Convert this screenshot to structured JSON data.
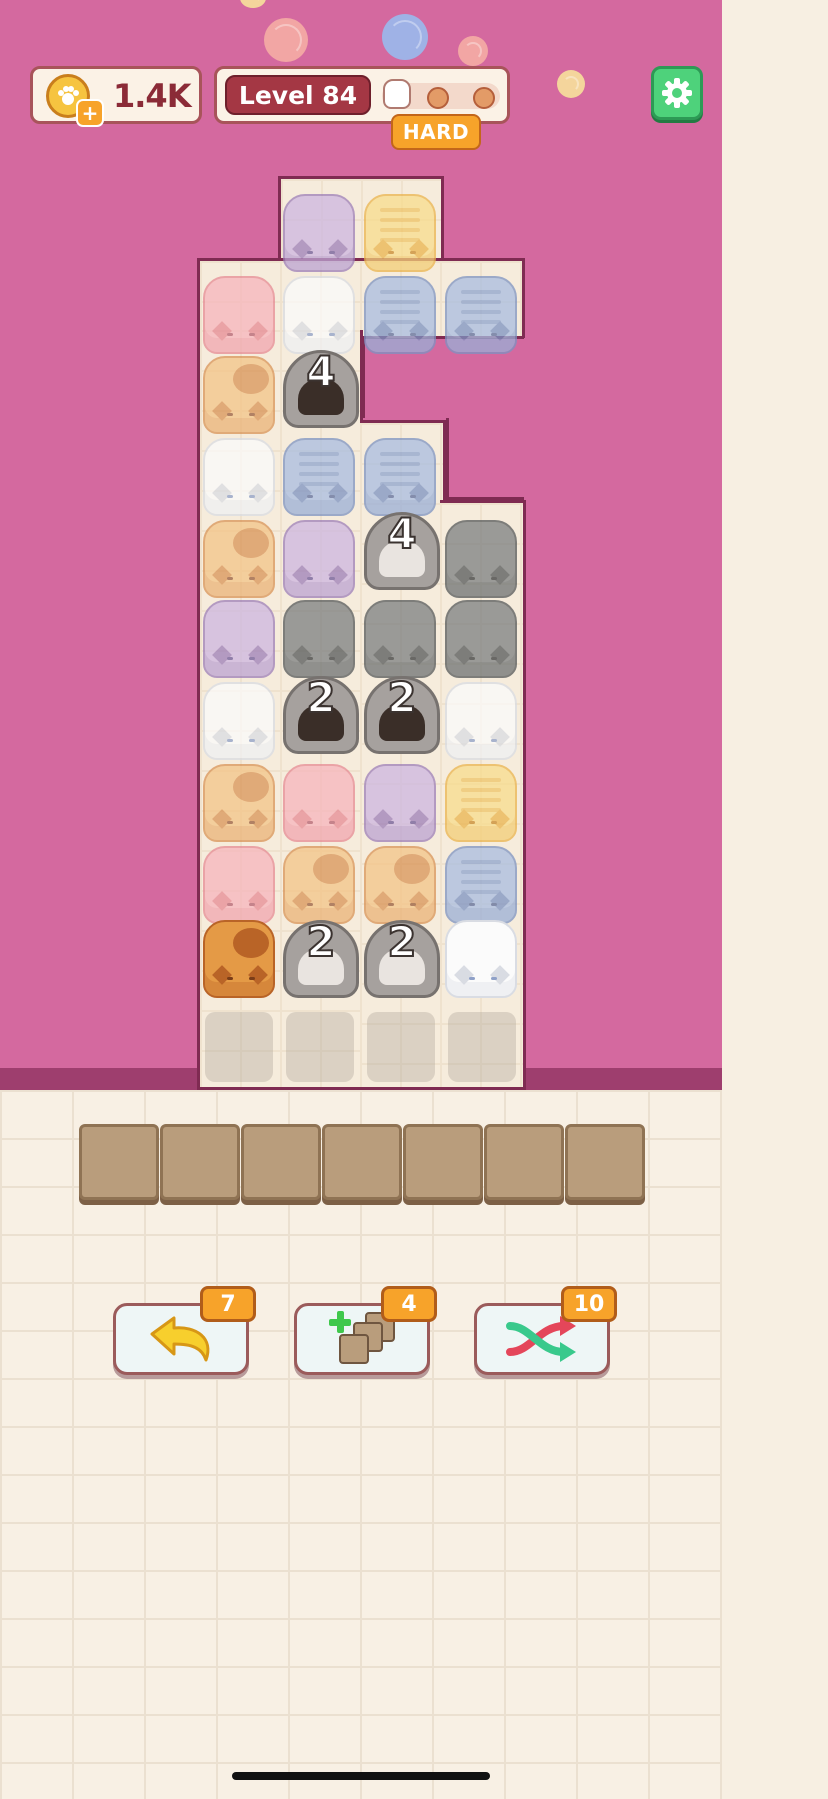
{
  "header": {
    "coins": "1.4K",
    "level_label": "Level 84",
    "difficulty": "HARD"
  },
  "icons": {
    "coin": "paw-coin-icon",
    "add": "plus-icon",
    "settings": "gear-icon",
    "undo": "undo-arrow-icon",
    "extra_slot": "add-slot-icon",
    "shuffle": "shuffle-icon"
  },
  "level_progress": {
    "stages_total": 3,
    "stage_reached": 1
  },
  "board": {
    "hidden_stacks": [
      {
        "count": "4"
      },
      {
        "count": "4"
      },
      {
        "count": "2"
      },
      {
        "count": "2"
      },
      {
        "count": "2"
      },
      {
        "count": "2"
      }
    ]
  },
  "tray": {
    "slots": 7
  },
  "powerups": {
    "undo_count": "7",
    "add_slot_count": "4",
    "shuffle_count": "10"
  },
  "colors": {
    "background_pink": "#d4699f",
    "accent_orange": "#f7a32a",
    "settings_green": "#4ed27b"
  }
}
